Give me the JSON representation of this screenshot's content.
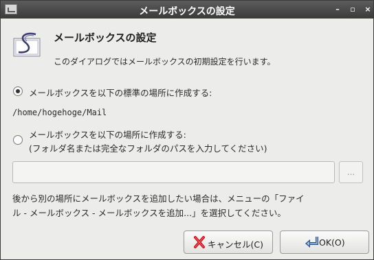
{
  "window": {
    "title": "メールボックスの設定"
  },
  "header": {
    "heading": "メールボックスの設定",
    "description": "このダイアログではメールボックスの初期設定を行います。"
  },
  "options": {
    "default_location_label": "メールボックスを以下の標準の場所に作成する:",
    "default_path": "/home/hogehoge/Mail",
    "custom_location_label": "メールボックスを以下の場所に作成する:",
    "custom_location_hint": "(フォルダ名または完全なフォルダのパスを入力してください)",
    "selected": "default"
  },
  "path_input": {
    "value": "",
    "browse_label": "..."
  },
  "info": {
    "line1": "後から別の場所にメールボックスを追加したい場合は、メニューの「ファイ",
    "line2": "ル - メールボックス - メールボックスを追加...」を選択してください。"
  },
  "buttons": {
    "cancel_label": "キャンセル(C)",
    "ok_label": "OK(O)"
  },
  "icons": {
    "app": "mail-app-icon",
    "header": "sylpheed-logo-icon",
    "cancel": "red-x-icon",
    "ok": "enter-arrow-icon"
  }
}
